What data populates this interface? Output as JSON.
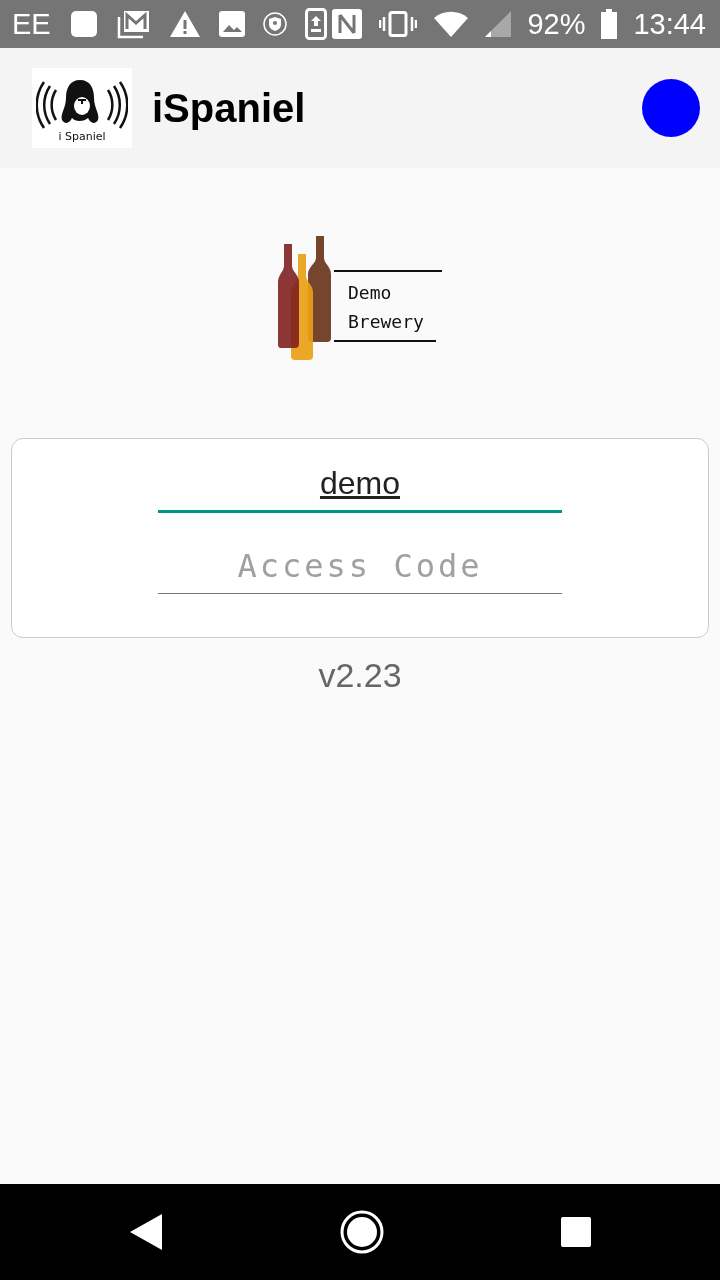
{
  "status_bar": {
    "carrier": "EE",
    "battery": "92%",
    "time": "13:44"
  },
  "app_bar": {
    "logo_text": "i Spaniel",
    "title": "iSpaniel",
    "status_dot": {
      "color": "#0000ff"
    }
  },
  "brand_logo": {
    "lines": [
      "Demo",
      "Brewery"
    ]
  },
  "login": {
    "username": {
      "value": "demo",
      "focused": true
    },
    "access_code": {
      "placeholder": "Access Code"
    }
  },
  "version": "v2.23"
}
